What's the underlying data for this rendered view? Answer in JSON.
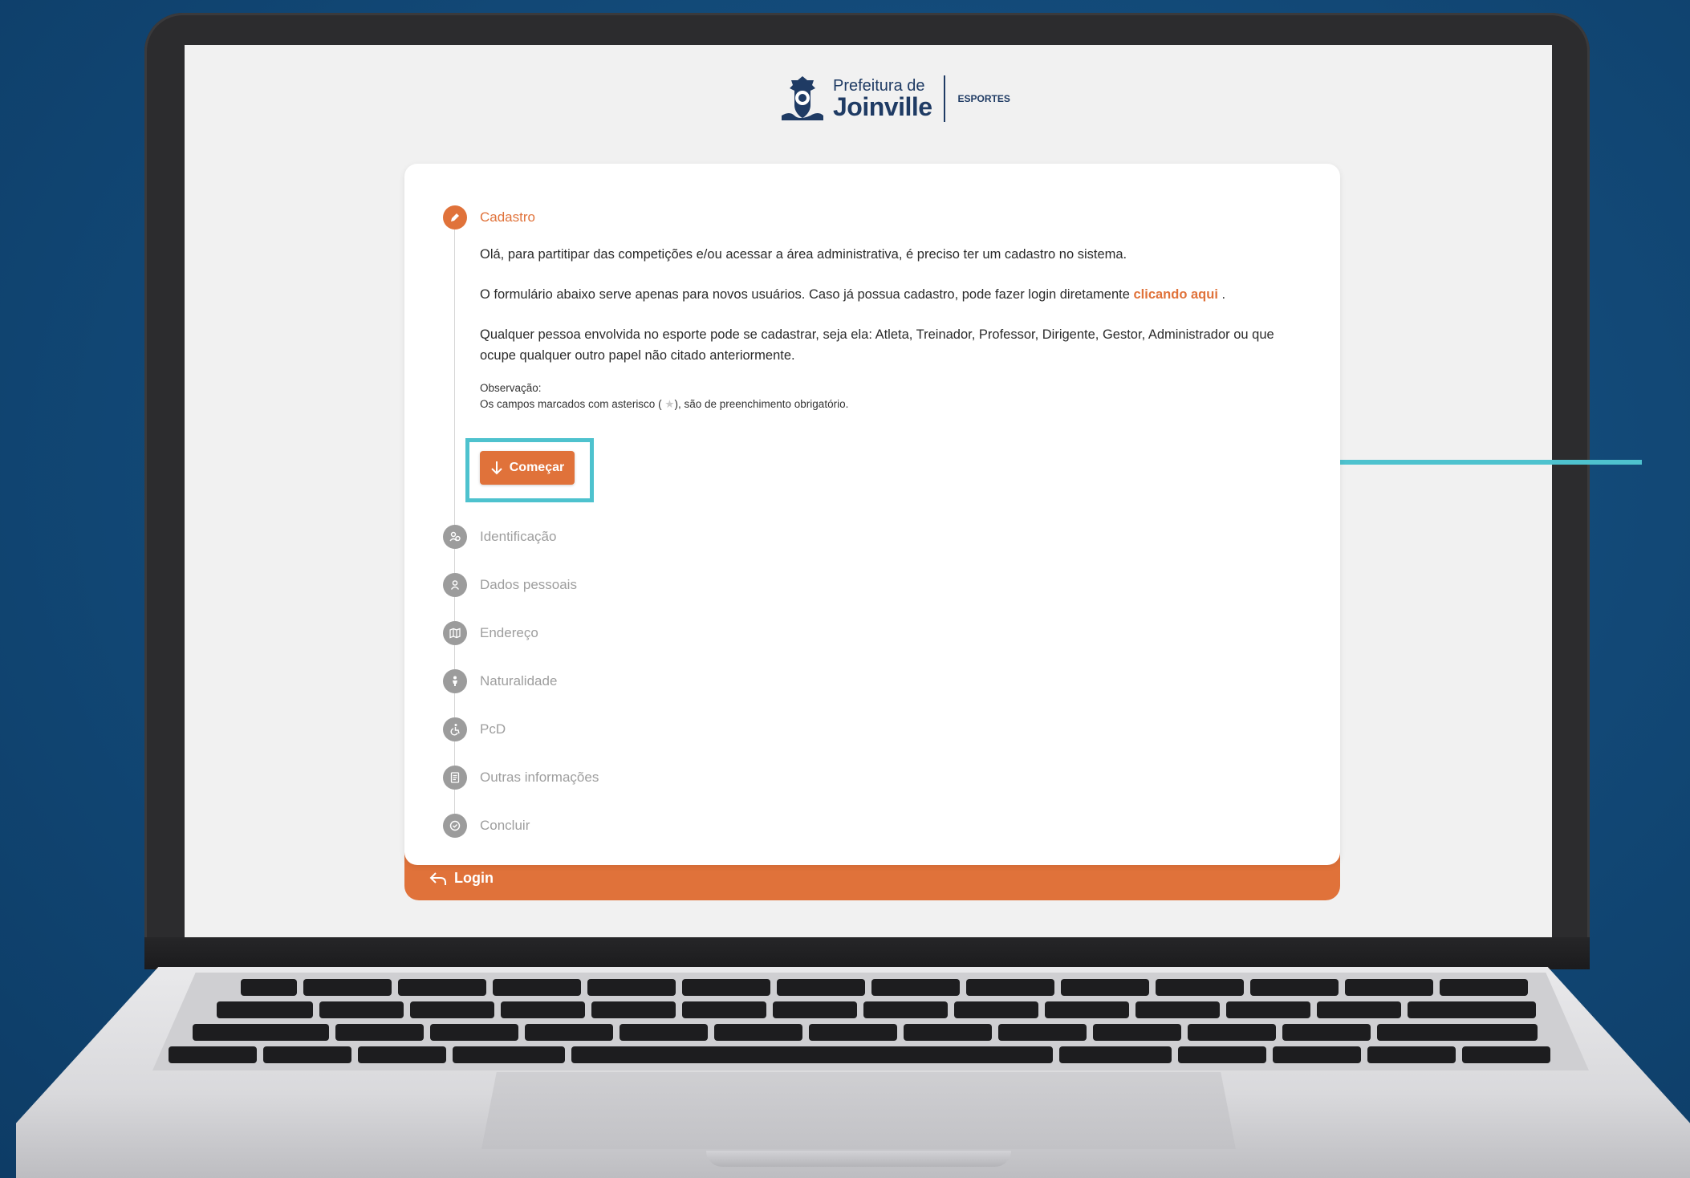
{
  "header": {
    "logo_line1": "Prefeitura de",
    "logo_line2": "Joinville",
    "department": "ESPORTES"
  },
  "steps": [
    {
      "label": "Cadastro",
      "icon": "pencil-icon",
      "active": true
    },
    {
      "label": "Identificação",
      "icon": "id-icon",
      "active": false
    },
    {
      "label": "Dados pessoais",
      "icon": "person-icon",
      "active": false
    },
    {
      "label": "Endereço",
      "icon": "map-icon",
      "active": false
    },
    {
      "label": "Naturalidade",
      "icon": "baby-icon",
      "active": false
    },
    {
      "label": "PcD",
      "icon": "wheelchair-icon",
      "active": false
    },
    {
      "label": "Outras informações",
      "icon": "document-icon",
      "active": false
    },
    {
      "label": "Concluir",
      "icon": "check-icon",
      "active": false
    }
  ],
  "intro": {
    "p1": "Olá, para partitipar das competições e/ou acessar a área administrativa, é preciso ter um cadastro no sistema.",
    "p2_before": "O formulário abaixo serve apenas para novos usuários. Caso já possua cadastro, pode fazer login diretamente ",
    "p2_link": "clicando aqui",
    "p2_after": " .",
    "p3": "Qualquer pessoa envolvida no esporte pode se cadastrar, seja ela: Atleta, Treinador, Professor, Dirigente, Gestor, Administrador ou que ocupe qualquer outro papel não citado anteriormente.",
    "obs_title": "Observação:",
    "obs_before": "Os campos marcados com asterisco (",
    "obs_symbol": "★",
    "obs_after": "), são de preenchimento obrigatório."
  },
  "start_button": {
    "label": "Começar"
  },
  "footer": {
    "login_label": "Login"
  },
  "colors": {
    "accent": "#e0723a",
    "highlight": "#4ec2ce",
    "background": "#134b7a"
  }
}
